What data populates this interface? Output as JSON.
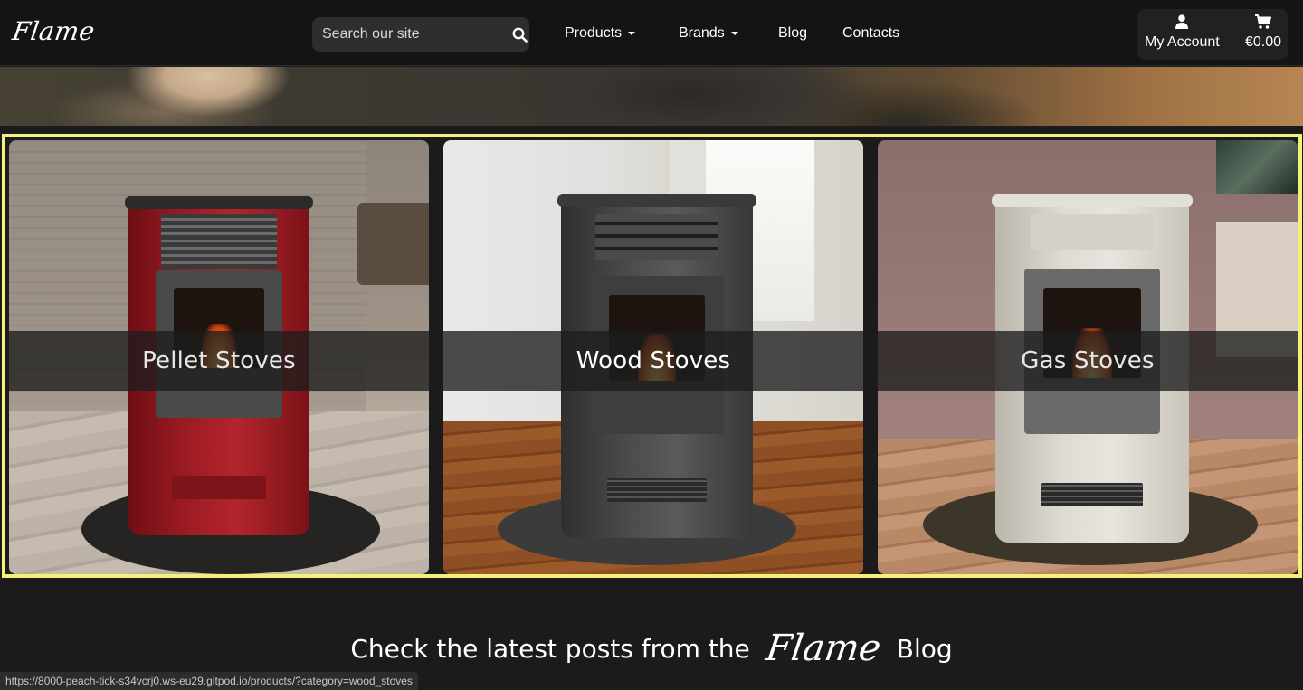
{
  "brand": {
    "logo_text": "Flame"
  },
  "search": {
    "placeholder": "Search our site"
  },
  "nav": {
    "products": "Products",
    "brands": "Brands",
    "blog": "Blog",
    "contacts": "Contacts"
  },
  "account": {
    "my_account": "My Account",
    "cart_total": "€0.00"
  },
  "categories": [
    {
      "label": "Pellet Stoves"
    },
    {
      "label": "Wood Stoves"
    },
    {
      "label": "Gas Stoves"
    }
  ],
  "blog_section": {
    "prefix": "Check the latest posts from the",
    "logo": "Flame",
    "suffix": "Blog"
  },
  "status_bar": {
    "url": "https://8000-peach-tick-s34vcrj0.ws-eu29.gitpod.io/products/?category=wood_stoves"
  },
  "colors": {
    "highlight_border": "#f3f17a",
    "nav_bg": "#141414",
    "page_bg": "#1b1b1b"
  }
}
